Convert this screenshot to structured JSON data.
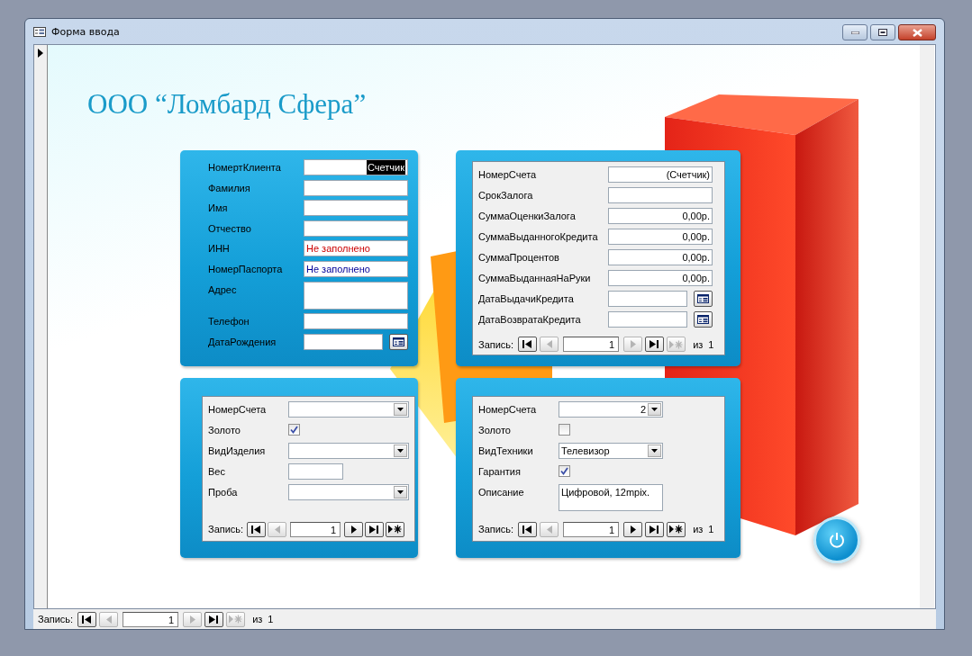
{
  "window": {
    "title": "Форма ввода"
  },
  "heading": "ООО “Ломбард Сфера”",
  "client_panel": {
    "fields": [
      {
        "label": "НомертКлиента",
        "kind": "counter",
        "value": "Счетчик",
        "highlighted": true
      },
      {
        "label": "Фамилия",
        "kind": "text"
      },
      {
        "label": "Имя",
        "kind": "text"
      },
      {
        "label": "Отчество",
        "kind": "text"
      },
      {
        "label": "ИНН",
        "kind": "text",
        "value": "Не заполнено",
        "color": "#cc0000"
      },
      {
        "label": "НомерПаспорта",
        "kind": "text",
        "value": "Не заполнено",
        "color": "#000099"
      },
      {
        "label": "Адрес",
        "kind": "memo"
      },
      {
        "label": "Телефон",
        "kind": "text"
      },
      {
        "label": "ДатаРождения",
        "kind": "date"
      }
    ]
  },
  "credit_panel": {
    "fields": [
      {
        "label": "НомерСчета",
        "kind": "counter",
        "value": "(Счетчик)",
        "highlighted": false
      },
      {
        "label": "СрокЗалога",
        "kind": "text"
      },
      {
        "label": "СуммаОценкиЗалога",
        "kind": "currency",
        "value": "0,00р."
      },
      {
        "label": "СуммаВыданногоКредита",
        "kind": "currency",
        "value": "0,00р."
      },
      {
        "label": "СуммаПроцентов",
        "kind": "currency",
        "value": "0,00р."
      },
      {
        "label": "СуммаВыданнаяНаРуки",
        "kind": "currency",
        "value": "0,00р."
      },
      {
        "label": "ДатаВыдачиКредита",
        "kind": "date"
      },
      {
        "label": "ДатаВозвратаКредита",
        "kind": "date"
      }
    ],
    "navigation": {
      "label": "Запись:",
      "current": "1",
      "of_label": "из",
      "total": "1",
      "buttons": [
        {
          "kind": "first",
          "disabled": false
        },
        {
          "kind": "prev",
          "disabled": true
        },
        {
          "kind": "next",
          "disabled": true
        },
        {
          "kind": "last",
          "disabled": false
        },
        {
          "kind": "new",
          "disabled": true
        }
      ]
    }
  },
  "gold_panel": {
    "fields": [
      {
        "label": "НомерСчета",
        "kind": "combo"
      },
      {
        "label": "Золото",
        "kind": "checkbox",
        "checked": true
      },
      {
        "label": "ВидИзделия",
        "kind": "combo"
      },
      {
        "label": "Вес",
        "kind": "short"
      },
      {
        "label": "Проба",
        "kind": "combo"
      }
    ],
    "navigation": {
      "label": "Запись:",
      "current": "1",
      "buttons": [
        {
          "kind": "first",
          "disabled": false
        },
        {
          "kind": "prev",
          "disabled": true
        },
        {
          "kind": "next",
          "disabled": false
        },
        {
          "kind": "last",
          "disabled": false
        },
        {
          "kind": "new",
          "disabled": false
        }
      ]
    }
  },
  "tech_panel": {
    "fields": [
      {
        "label": "НомерСчета",
        "kind": "number_combo",
        "value": "2"
      },
      {
        "label": "Золото",
        "kind": "checkbox",
        "checked": false
      },
      {
        "label": "ВидТехники",
        "kind": "combo",
        "value": "Телевизор"
      },
      {
        "label": "Гарантия",
        "kind": "checkbox",
        "checked": true
      },
      {
        "label": "Описание",
        "kind": "memo",
        "value": "Цифровой, 12mpix."
      }
    ],
    "navigation": {
      "label": "Запись:",
      "current": "1",
      "of_label": "из",
      "total": "1",
      "buttons": [
        {
          "kind": "first",
          "disabled": false
        },
        {
          "kind": "prev",
          "disabled": true
        },
        {
          "kind": "next",
          "disabled": false
        },
        {
          "kind": "last",
          "disabled": false
        },
        {
          "kind": "new",
          "disabled": false
        }
      ]
    }
  },
  "navigation": {
    "label": "Запись:",
    "current": "1",
    "of_label": "из",
    "total": "1",
    "buttons": [
      {
        "kind": "first",
        "disabled": false
      },
      {
        "kind": "prev",
        "disabled": true
      },
      {
        "kind": "next",
        "disabled": true
      },
      {
        "kind": "last",
        "disabled": false
      },
      {
        "kind": "new",
        "disabled": true
      }
    ]
  }
}
